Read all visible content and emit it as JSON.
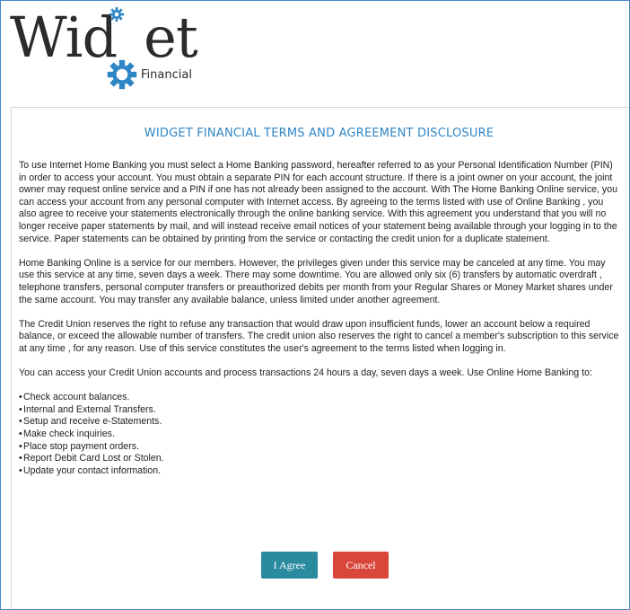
{
  "logo": {
    "word": "Widget",
    "word_prefix": "Wid",
    "word_suffix": "et",
    "subtitle": "Financial",
    "accent_color": "#2f86c5"
  },
  "disclosure": {
    "title": "WIDGET FINANCIAL TERMS AND AGREEMENT DISCLOSURE",
    "paragraphs": [
      "To use Internet Home Banking you must select a Home Banking password, hereafter referred to as your Personal Identification Number (PIN) in order to access your account. You must obtain a separate PIN for each account structure. If there is a joint owner on your account, the joint owner may request online service and a PIN if one has not already been assigned to the account. With The Home Banking Online service, you can access your account from any personal computer with Internet access. By agreeing to the terms listed with use of Online Banking , you also agree to receive your statements electronically through the online banking service. With this agreement you understand that you will no longer receive paper statements by mail, and will instead receive email notices of your statement being available through your logging in to the service. Paper statements can be obtained by printing from the service or contacting the credit union for a duplicate statement.",
      "Home Banking Online is a service for our members. However, the privileges given under this service may be canceled at any time. You may use this service at any time, seven days a week. There may some downtime. You are allowed only six (6) transfers by automatic overdraft , telephone transfers, personal computer transfers or preauthorized debits per month from your Regular Shares or Money Market shares under the same account. You may transfer any available balance, unless limited under another agreement.",
      "The Credit Union reserves the right to refuse any transaction that would draw upon insufficient funds, lower an account below a required balance, or exceed the allowable number of transfers. The credit union also reserves the right to cancel a member's subscription to this service at any time , for any reason. Use of this service constitutes the user's agreement to the terms listed when logging in.",
      "You can access your Credit Union accounts and process transactions 24 hours a day, seven days a week. Use Online Home Banking to:"
    ],
    "bullet_char": "•",
    "bullets": [
      "Check account balances.",
      "Internal and External Transfers.",
      "Setup and receive e-Statements.",
      "Make check inquiries.",
      "Place stop payment orders.",
      "Report Debit Card Lost or Stolen.",
      "Update your contact information."
    ]
  },
  "actions": {
    "agree_label": "I Agree",
    "cancel_label": "Cancel",
    "agree_color": "#2a8aa0",
    "cancel_color": "#d9473a"
  }
}
